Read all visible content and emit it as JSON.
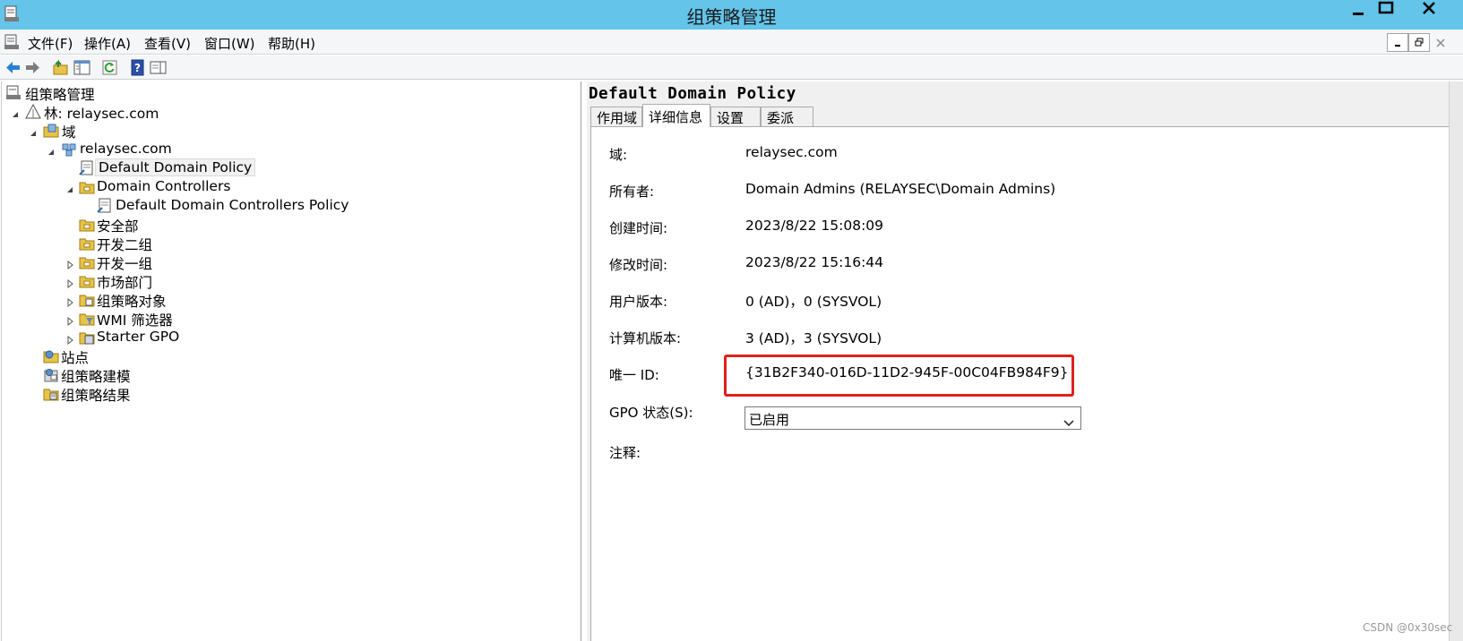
{
  "window": {
    "title": "组策略管理",
    "title_bar_color": "#64c4ea"
  },
  "menu": {
    "file": "文件(F)",
    "action": "操作(A)",
    "view": "查看(V)",
    "window": "窗口(W)",
    "help": "帮助(H)"
  },
  "toolbar": {
    "icons": [
      "back-arrow-icon",
      "forward-arrow-icon",
      "up-folder-icon",
      "show-hide-tree-icon",
      "refresh-icon",
      "help-icon",
      "show-hide-action-pane-icon"
    ]
  },
  "tree": {
    "root": "组策略管理",
    "forest": "林: relaysec.com",
    "domains": "域",
    "domain": "relaysec.com",
    "default_domain_policy": "Default Domain Policy",
    "domain_controllers": "Domain Controllers",
    "default_dc_policy": "Default Domain Controllers Policy",
    "ou_security": "安全部",
    "ou_dev2": "开发二组",
    "ou_dev1": "开发一组",
    "ou_marketing": "市场部门",
    "gpo_objects": "组策略对象",
    "wmi_filters": "WMI 筛选器",
    "starter_gpo": "Starter GPO",
    "sites": "站点",
    "modeling": "组策略建模",
    "results": "组策略结果"
  },
  "details": {
    "policy_title": "Default Domain Policy",
    "tabs": {
      "scope": "作用域",
      "details": "详细信息",
      "settings": "设置",
      "delegation": "委派"
    },
    "fields": {
      "domain_label": "域:",
      "domain_value": "relaysec.com",
      "owner_label": "所有者:",
      "owner_value": "Domain Admins (RELAYSEC\\Domain Admins)",
      "created_label": "创建时间:",
      "created_value": "2023/8/22 15:08:09",
      "modified_label": "修改时间:",
      "modified_value": "2023/8/22 15:16:44",
      "user_version_label": "用户版本:",
      "user_version_value": "0 (AD)，0 (SYSVOL)",
      "computer_version_label": "计算机版本:",
      "computer_version_value": "3 (AD)，3 (SYSVOL)",
      "unique_id_label": "唯一 ID:",
      "unique_id_value": "{31B2F340-016D-11D2-945F-00C04FB984F9}",
      "gpo_status_label": "GPO 状态(S):",
      "gpo_status_value": "已启用",
      "comment_label": "注释:"
    },
    "highlight_color": "#e0201b"
  },
  "watermark": "CSDN @0x30sec"
}
